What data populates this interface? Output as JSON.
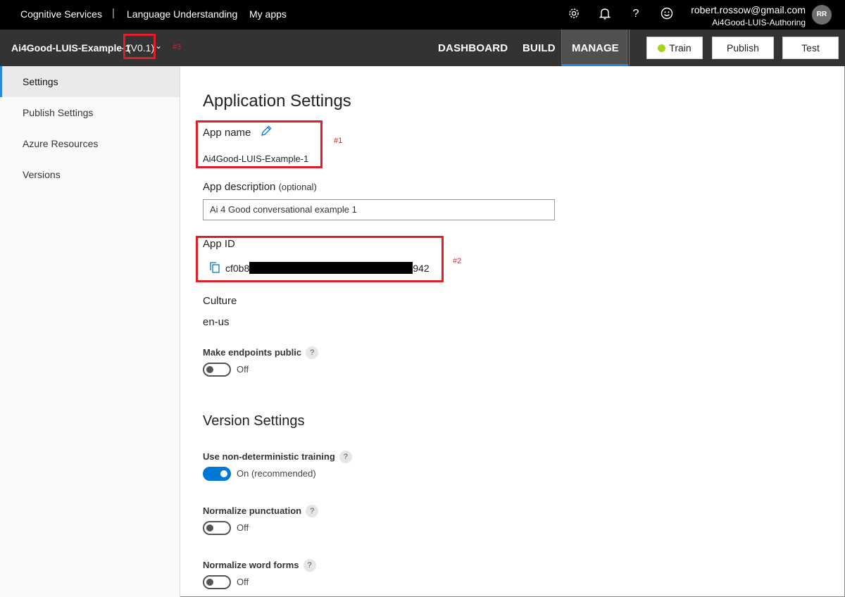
{
  "topbar": {
    "brand": "Cognitive Services",
    "separator": "|",
    "product": "Language Understanding",
    "my_apps": "My apps",
    "help_glyph": "?",
    "user_email": "robert.rossow@gmail.com",
    "user_tenant": "Ai4Good-LUIS-Authoring",
    "avatar_initials": "RR",
    "icons": [
      "gear-icon",
      "bell-icon",
      "help-icon",
      "smiley-icon"
    ]
  },
  "appbar": {
    "app_name": "Ai4Good-LUIS-Example-1",
    "version": "(V0.1)",
    "chevron": "⌄",
    "tabs": [
      "DASHBOARD",
      "BUILD",
      "MANAGE"
    ],
    "active_tab": "MANAGE",
    "train_label": "Train",
    "publish_label": "Publish",
    "test_label": "Test",
    "train_status_color": "#a4d21d"
  },
  "annotations": {
    "a1": "#1",
    "a2": "#2",
    "a3": "#3",
    "color": "#e01e2b"
  },
  "sidebar": {
    "items": [
      {
        "label": "Settings",
        "active": true
      },
      {
        "label": "Publish Settings",
        "active": false
      },
      {
        "label": "Azure Resources",
        "active": false
      },
      {
        "label": "Versions",
        "active": false
      }
    ]
  },
  "main": {
    "title": "Application Settings",
    "app_name_label": "App name",
    "app_name_value": "Ai4Good-LUIS-Example-1",
    "app_description_label": "App description",
    "app_description_optional": "(optional)",
    "app_description_value": "Ai 4 Good conversational example 1",
    "app_id_label": "App ID",
    "app_id_prefix": "cf0b8",
    "app_id_suffix": "942",
    "culture_label": "Culture",
    "culture_value": "en-us",
    "endpoints_public_label": "Make endpoints public",
    "endpoints_public_state": "Off",
    "version_settings_title": "Version Settings",
    "nondeterministic_label": "Use non-deterministic training",
    "nondeterministic_state": "On (recommended)",
    "normalize_punctuation_label": "Normalize punctuation",
    "normalize_punctuation_state": "Off",
    "normalize_word_forms_label": "Normalize word forms",
    "normalize_word_forms_state": "Off",
    "help_glyph": "?"
  },
  "colors": {
    "accent": "#0078d4",
    "tab_underline": "#2b88d8"
  }
}
